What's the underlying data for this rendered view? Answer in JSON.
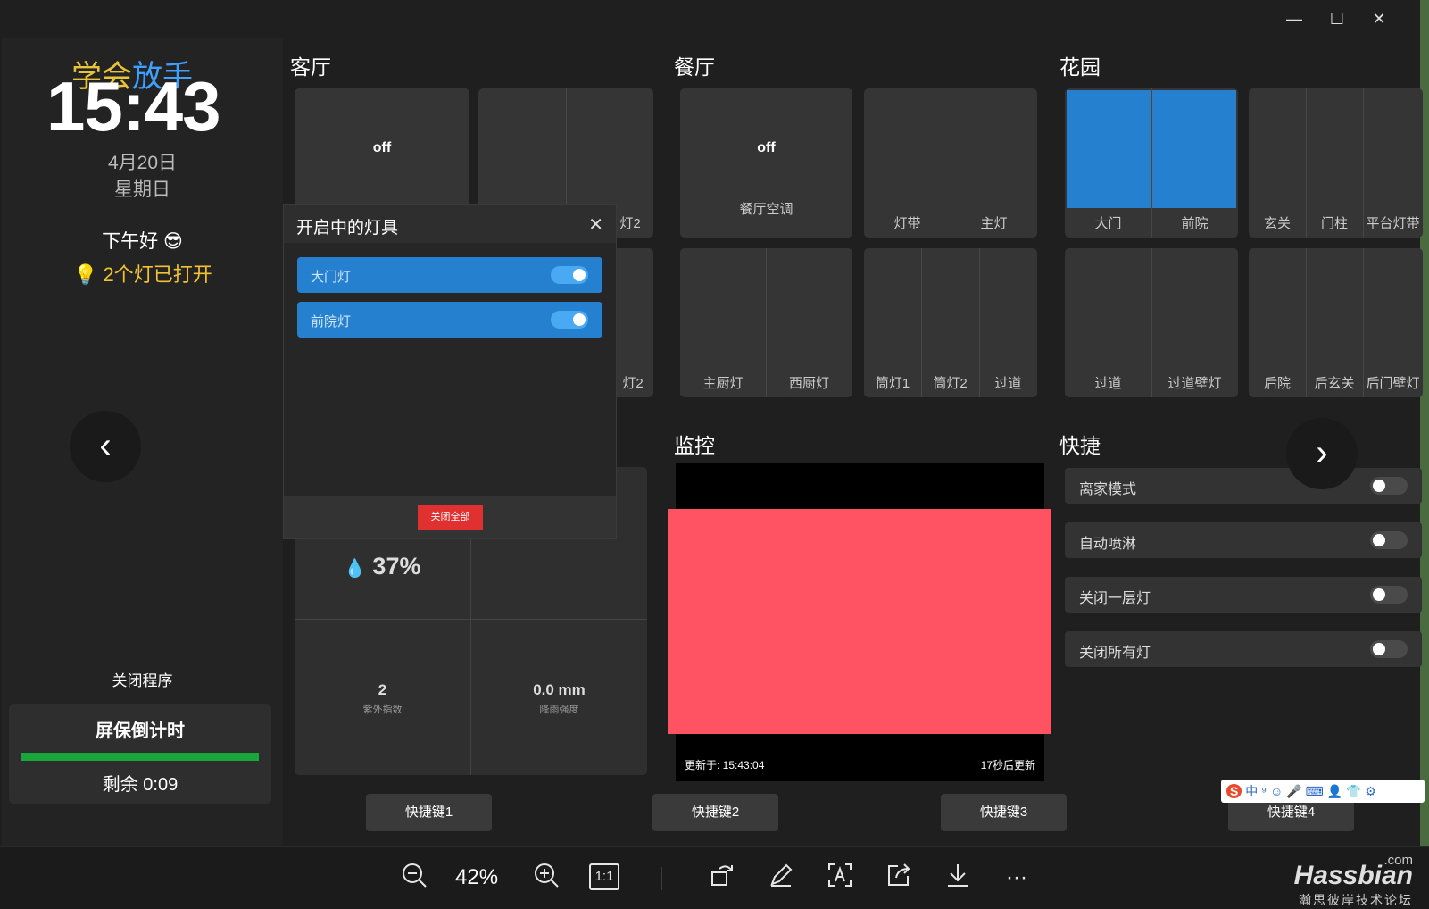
{
  "window": {
    "minimize": "—",
    "maximize": "☐",
    "close": "✕"
  },
  "left": {
    "motto_a": "学会",
    "motto_b": "放手",
    "clock": "15:43",
    "date": "4月20日",
    "weekday": "星期日",
    "greeting": "下午好 😎",
    "lights_on": "2个灯已打开",
    "prev": "‹",
    "close_program": "关闭程序",
    "saver_title": "屏保倒计时",
    "saver_progress": 1.0,
    "saver_remaining": "剩余 0:09"
  },
  "sections": {
    "living": "客厅",
    "dining": "餐厅",
    "garden": "花园",
    "monitor": "监控",
    "quick": "快捷"
  },
  "living": {
    "off": "off",
    "partial_label_1": "灯2",
    "partial_label_2": "灯2"
  },
  "dining": {
    "ac_off": "off",
    "ac_label": "餐厅空调",
    "strip": "灯带",
    "main": "主灯",
    "kitchen_main": "主厨灯",
    "kitchen_west": "西厨灯",
    "spot1": "筒灯1",
    "spot2": "筒灯2",
    "aisle": "过道"
  },
  "garden": {
    "gate": "大门",
    "front": "前院",
    "porch": "玄关",
    "pillar": "门柱",
    "terrace": "平台灯带",
    "aisle": "过道",
    "aisle_wall": "过道壁灯",
    "back": "后院",
    "back_porch": "后玄关",
    "back_wall": "后门壁灯"
  },
  "weather": {
    "humidity": "37%",
    "uv_value": "2",
    "uv_label": "紫外指数",
    "rain_value": "0.0 mm",
    "rain_label": "降雨强度"
  },
  "monitor": {
    "updated": "更新于: 15:43:04",
    "next": "17秒后更新"
  },
  "quick": {
    "next": "›",
    "items": [
      {
        "label": "离家模式",
        "on": false
      },
      {
        "label": "自动喷淋",
        "on": false
      },
      {
        "label": "关闭一层灯",
        "on": false
      },
      {
        "label": "关闭所有灯",
        "on": false
      }
    ]
  },
  "shortcuts": [
    "快捷键1",
    "快捷键2",
    "快捷键3",
    "快捷键4"
  ],
  "popup": {
    "title": "开启中的灯具",
    "close": "✕",
    "items": [
      {
        "label": "大门灯",
        "on": true
      },
      {
        "label": "前院灯",
        "on": true
      }
    ],
    "close_all": "关闭全部"
  },
  "viewer": {
    "zoom": "42%",
    "one_to_one": "1:1",
    "more": "···"
  },
  "watermark": {
    "domain": ".com",
    "name": "Hassbian",
    "sub": "瀚思彼岸技术论坛"
  },
  "ime": {
    "logo": "S",
    "lang": "中"
  },
  "colors": {
    "accent_blue": "#2580cf",
    "progress_green": "#19a63a",
    "camera_pink": "#ff5262",
    "warning_yellow": "#f2c230",
    "close_red": "#e03030"
  }
}
